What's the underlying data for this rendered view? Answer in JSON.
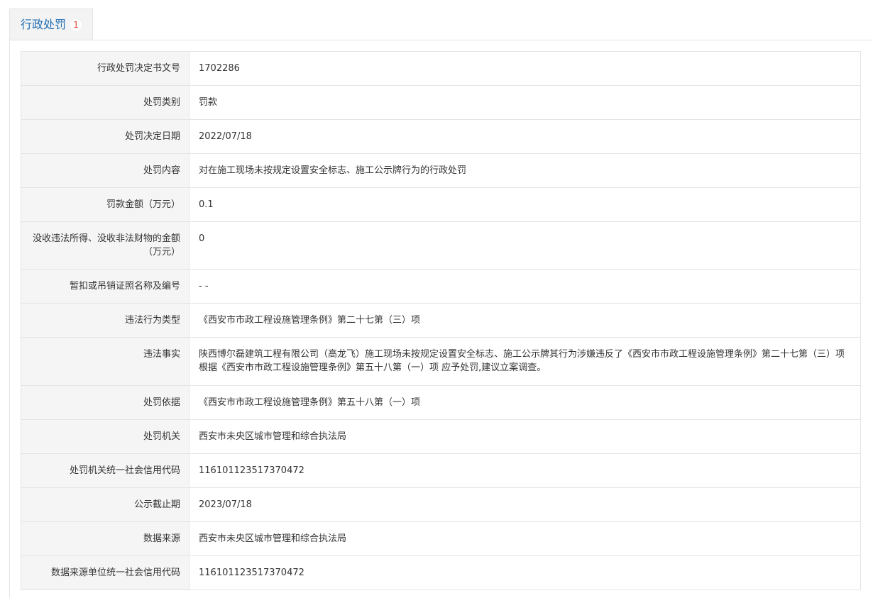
{
  "tab": {
    "title": "行政处罚",
    "count": "1"
  },
  "rows": [
    {
      "label": "行政处罚决定书文号",
      "value": "1702286"
    },
    {
      "label": "处罚类别",
      "value": "罚款"
    },
    {
      "label": "处罚决定日期",
      "value": "2022/07/18"
    },
    {
      "label": "处罚内容",
      "value": "对在施工现场未按规定设置安全标志、施工公示牌行为的行政处罚"
    },
    {
      "label": "罚款金额（万元）",
      "value": "0.1"
    },
    {
      "label": "没收违法所得、没收非法财物的金额（万元）",
      "value": "0"
    },
    {
      "label": "暂扣或吊销证照名称及编号",
      "value": "- -"
    },
    {
      "label": "违法行为类型",
      "value": "《西安市市政工程设施管理条例》第二十七第（三）项"
    },
    {
      "label": "违法事实",
      "value": "陕西博尔磊建筑工程有限公司（高龙飞）施工现场未按规定设置安全标志、施工公示牌其行为涉嫌违反了《西安市市政工程设施管理条例》第二十七第（三）项根据《西安市市政工程设施管理条例》第五十八第（一）项 应予处罚,建议立案调查。"
    },
    {
      "label": "处罚依据",
      "value": "《西安市市政工程设施管理条例》第五十八第（一）项"
    },
    {
      "label": "处罚机关",
      "value": "西安市未央区城市管理和综合执法局"
    },
    {
      "label": "处罚机关统一社会信用代码",
      "value": "116101123517370472"
    },
    {
      "label": "公示截止期",
      "value": "2023/07/18"
    },
    {
      "label": "数据来源",
      "value": "西安市未央区城市管理和综合执法局"
    },
    {
      "label": "数据来源单位统一社会信用代码",
      "value": "116101123517370472"
    }
  ]
}
